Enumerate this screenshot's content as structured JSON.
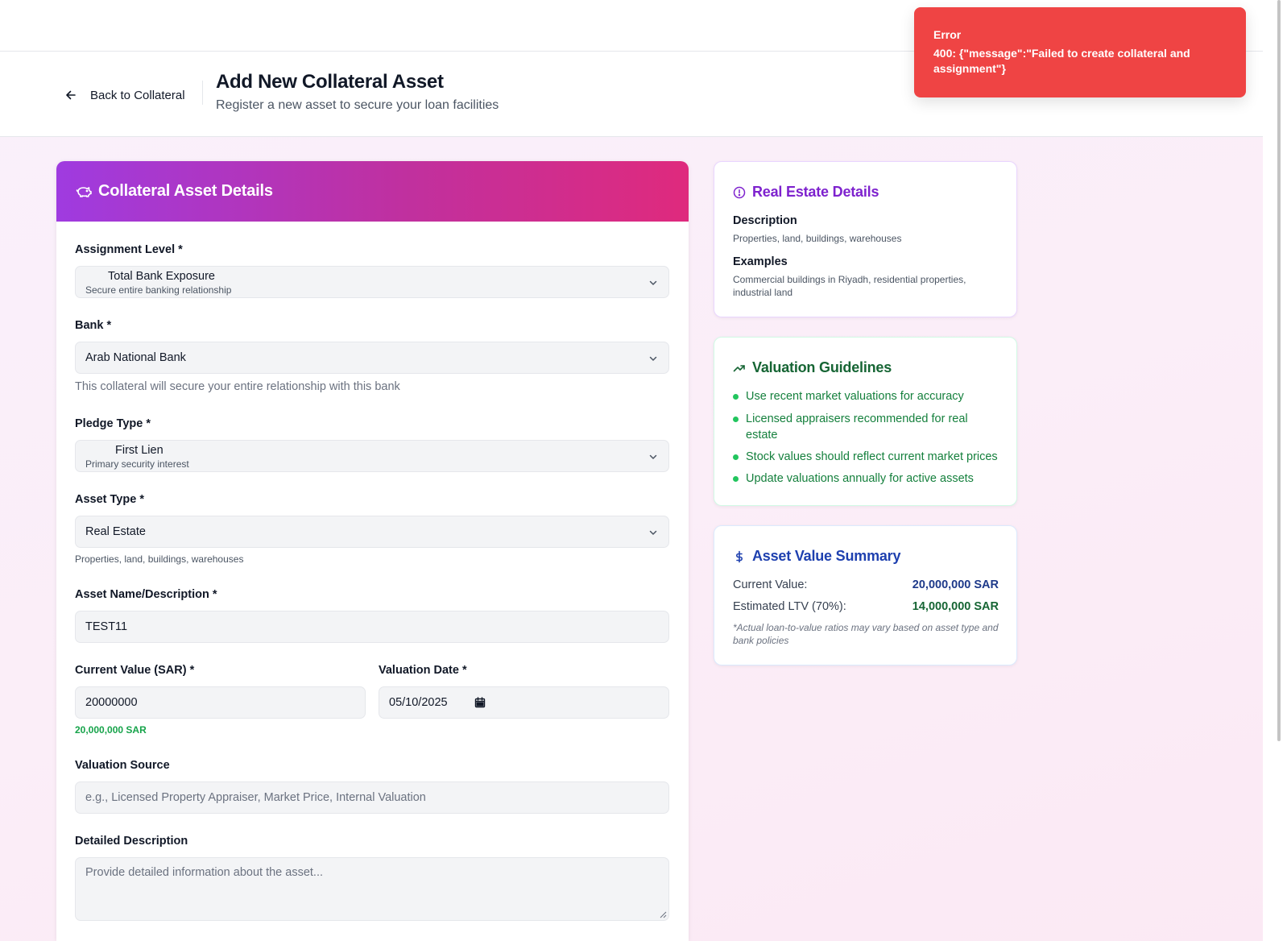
{
  "header": {
    "back_label": "Back to Collateral",
    "title": "Add New Collateral Asset",
    "subtitle": "Register a new asset to secure your loan facilities"
  },
  "toast": {
    "title": "Error",
    "message": "400: {\"message\":\"Failed to create collateral and assignment\"}",
    "color": "#ef4444"
  },
  "form": {
    "card_title": "Collateral Asset Details",
    "assignment_level": {
      "label": "Assignment Level *",
      "value": "Total Bank Exposure",
      "description": "Secure entire banking relationship"
    },
    "bank": {
      "label": "Bank *",
      "value": "Arab National Bank",
      "hint": "This collateral will secure your entire relationship with this bank"
    },
    "pledge_type": {
      "label": "Pledge Type *",
      "value": "First Lien",
      "description": "Primary security interest"
    },
    "asset_type": {
      "label": "Asset Type *",
      "value": "Real Estate",
      "hint": "Properties, land, buildings, warehouses"
    },
    "asset_name": {
      "label": "Asset Name/Description *",
      "value": "TEST11"
    },
    "current_value": {
      "label": "Current Value (SAR) *",
      "value": "20000000",
      "formatted": "20,000,000 SAR"
    },
    "valuation_date": {
      "label": "Valuation Date *",
      "value": "05/10/2025"
    },
    "valuation_source": {
      "label": "Valuation Source",
      "placeholder": "e.g., Licensed Property Appraiser, Market Price, Internal Valuation"
    },
    "detailed_description": {
      "label": "Detailed Description",
      "placeholder": "Provide detailed information about the asset..."
    }
  },
  "real_estate_card": {
    "title": "Real Estate Details",
    "description_heading": "Description",
    "description_text": "Properties, land, buildings, warehouses",
    "examples_heading": "Examples",
    "examples_text": "Commercial buildings in Riyadh, residential properties, industrial land",
    "accent": "#7e22ce"
  },
  "guidelines_card": {
    "title": "Valuation Guidelines",
    "items": [
      "Use recent market valuations for accuracy",
      "Licensed appraisers recommended for real estate",
      "Stock values should reflect current market prices",
      "Update valuations annually for active assets"
    ],
    "accent": "#166534"
  },
  "summary_card": {
    "title": "Asset Value Summary",
    "current_value_label": "Current Value:",
    "current_value": "20,000,000 SAR",
    "ltv_label": "Estimated LTV (70%):",
    "ltv_value": "14,000,000 SAR",
    "note": "*Actual loan-to-value ratios may vary based on asset type and bank policies",
    "accent": "#1e40af"
  }
}
